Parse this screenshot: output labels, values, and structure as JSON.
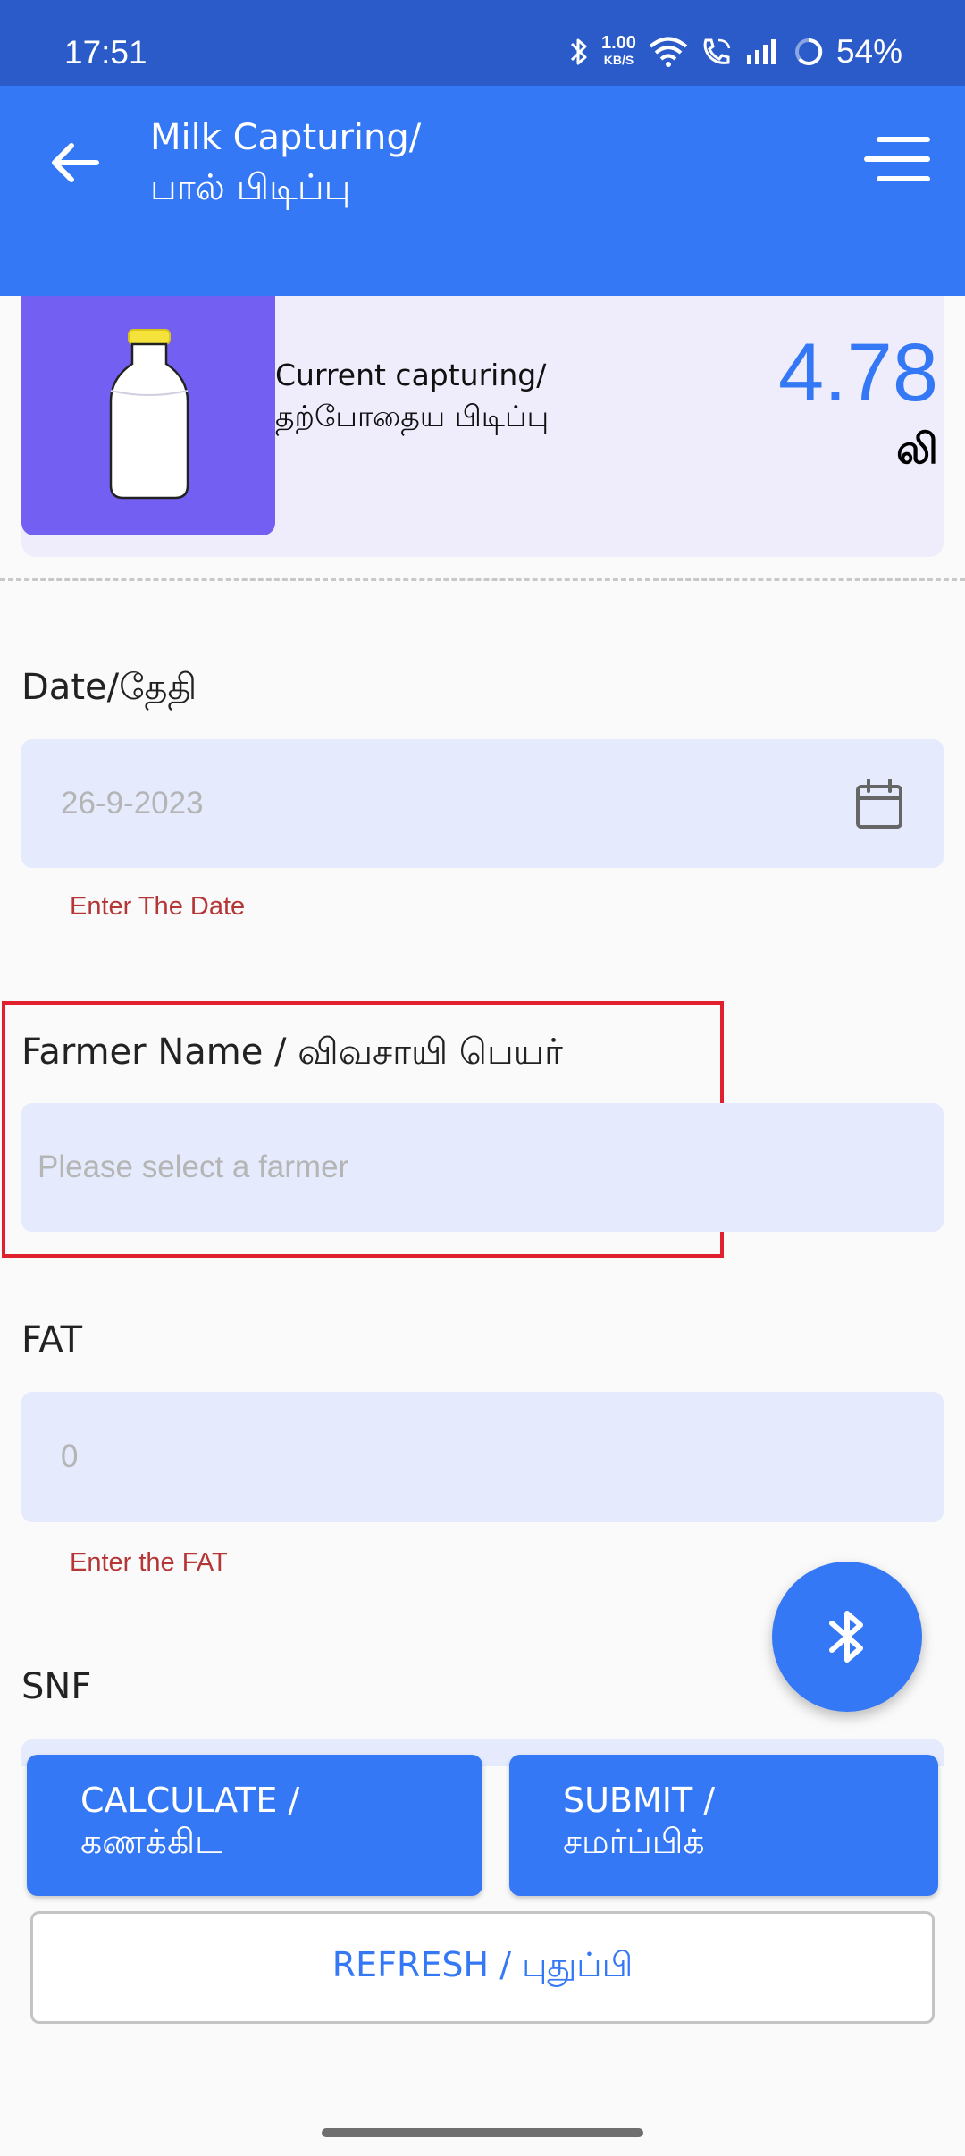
{
  "status_bar": {
    "time": "17:51",
    "net_speed_value": "1.00",
    "net_speed_unit": "KB/S",
    "battery": "54%",
    "icons": [
      "bluetooth-icon",
      "wifi-icon",
      "wifi-call-icon",
      "signal-icon",
      "battery-ring-icon"
    ]
  },
  "app_bar": {
    "title_line1": "Milk Capturing/",
    "title_line2": "பால் பிடிப்பு",
    "back_icon": "back-arrow-icon",
    "menu_icon": "menu-icon"
  },
  "capture_card": {
    "label_line1": "Current capturing/",
    "label_line2": "தற்போதைய பிடிப்பு",
    "value": "4.78",
    "unit": "லி"
  },
  "date_field": {
    "label": "Date/தேதி",
    "value": "26-9-2023",
    "error": "Enter The Date"
  },
  "farmer_field": {
    "label": "Farmer Name / விவசாயி பெயர்",
    "placeholder": "Please select a farmer"
  },
  "fat_field": {
    "label": "FAT",
    "value": "0",
    "error": "Enter the FAT"
  },
  "snf_field": {
    "label": "SNF"
  },
  "actions": {
    "calculate_line1": "CALCULATE /",
    "calculate_line2": "கணக்கிட",
    "submit_line1": "SUBMIT /",
    "submit_line2": "சமர்ப்பிக்",
    "refresh": "REFRESH / புதுப்பி"
  },
  "colors": {
    "status_bar": "#2a5bc8",
    "primary": "#3478f6",
    "input_bg": "#e5ebfd",
    "card_bg": "#efedfc",
    "bottle_bg": "#7360f2",
    "error": "#b53636",
    "highlight": "#e0202c"
  }
}
